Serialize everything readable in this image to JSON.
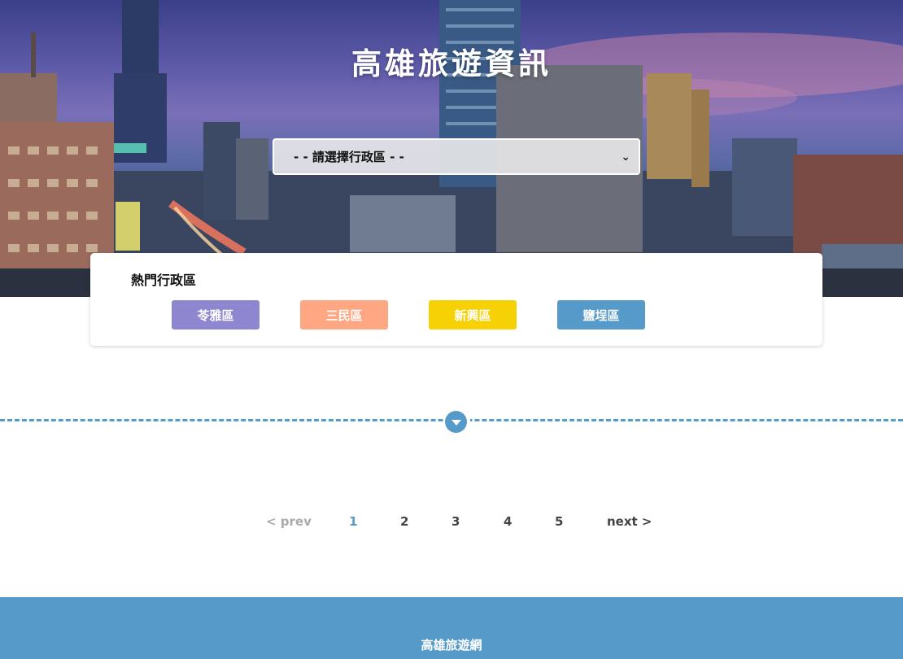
{
  "header": {
    "title": "高雄旅遊資訊",
    "select_placeholder": "- - 請選擇行政區 - -"
  },
  "hot_districts": {
    "title": "熱門行政區",
    "items": [
      {
        "label": "苓雅區",
        "color": "#8e86cf"
      },
      {
        "label": "三民區",
        "color": "#ffa782"
      },
      {
        "label": "新興區",
        "color": "#f5d105"
      },
      {
        "label": "鹽埕區",
        "color": "#559ac8"
      }
    ]
  },
  "divider": {
    "icon": "chevron-down-icon",
    "color": "#559ac8"
  },
  "pagination": {
    "prev": "< prev",
    "pages": [
      "1",
      "2",
      "3",
      "4",
      "5"
    ],
    "current": "1",
    "next": "next >"
  },
  "footer": {
    "text": "高雄旅遊網",
    "color": "#559ac8"
  }
}
